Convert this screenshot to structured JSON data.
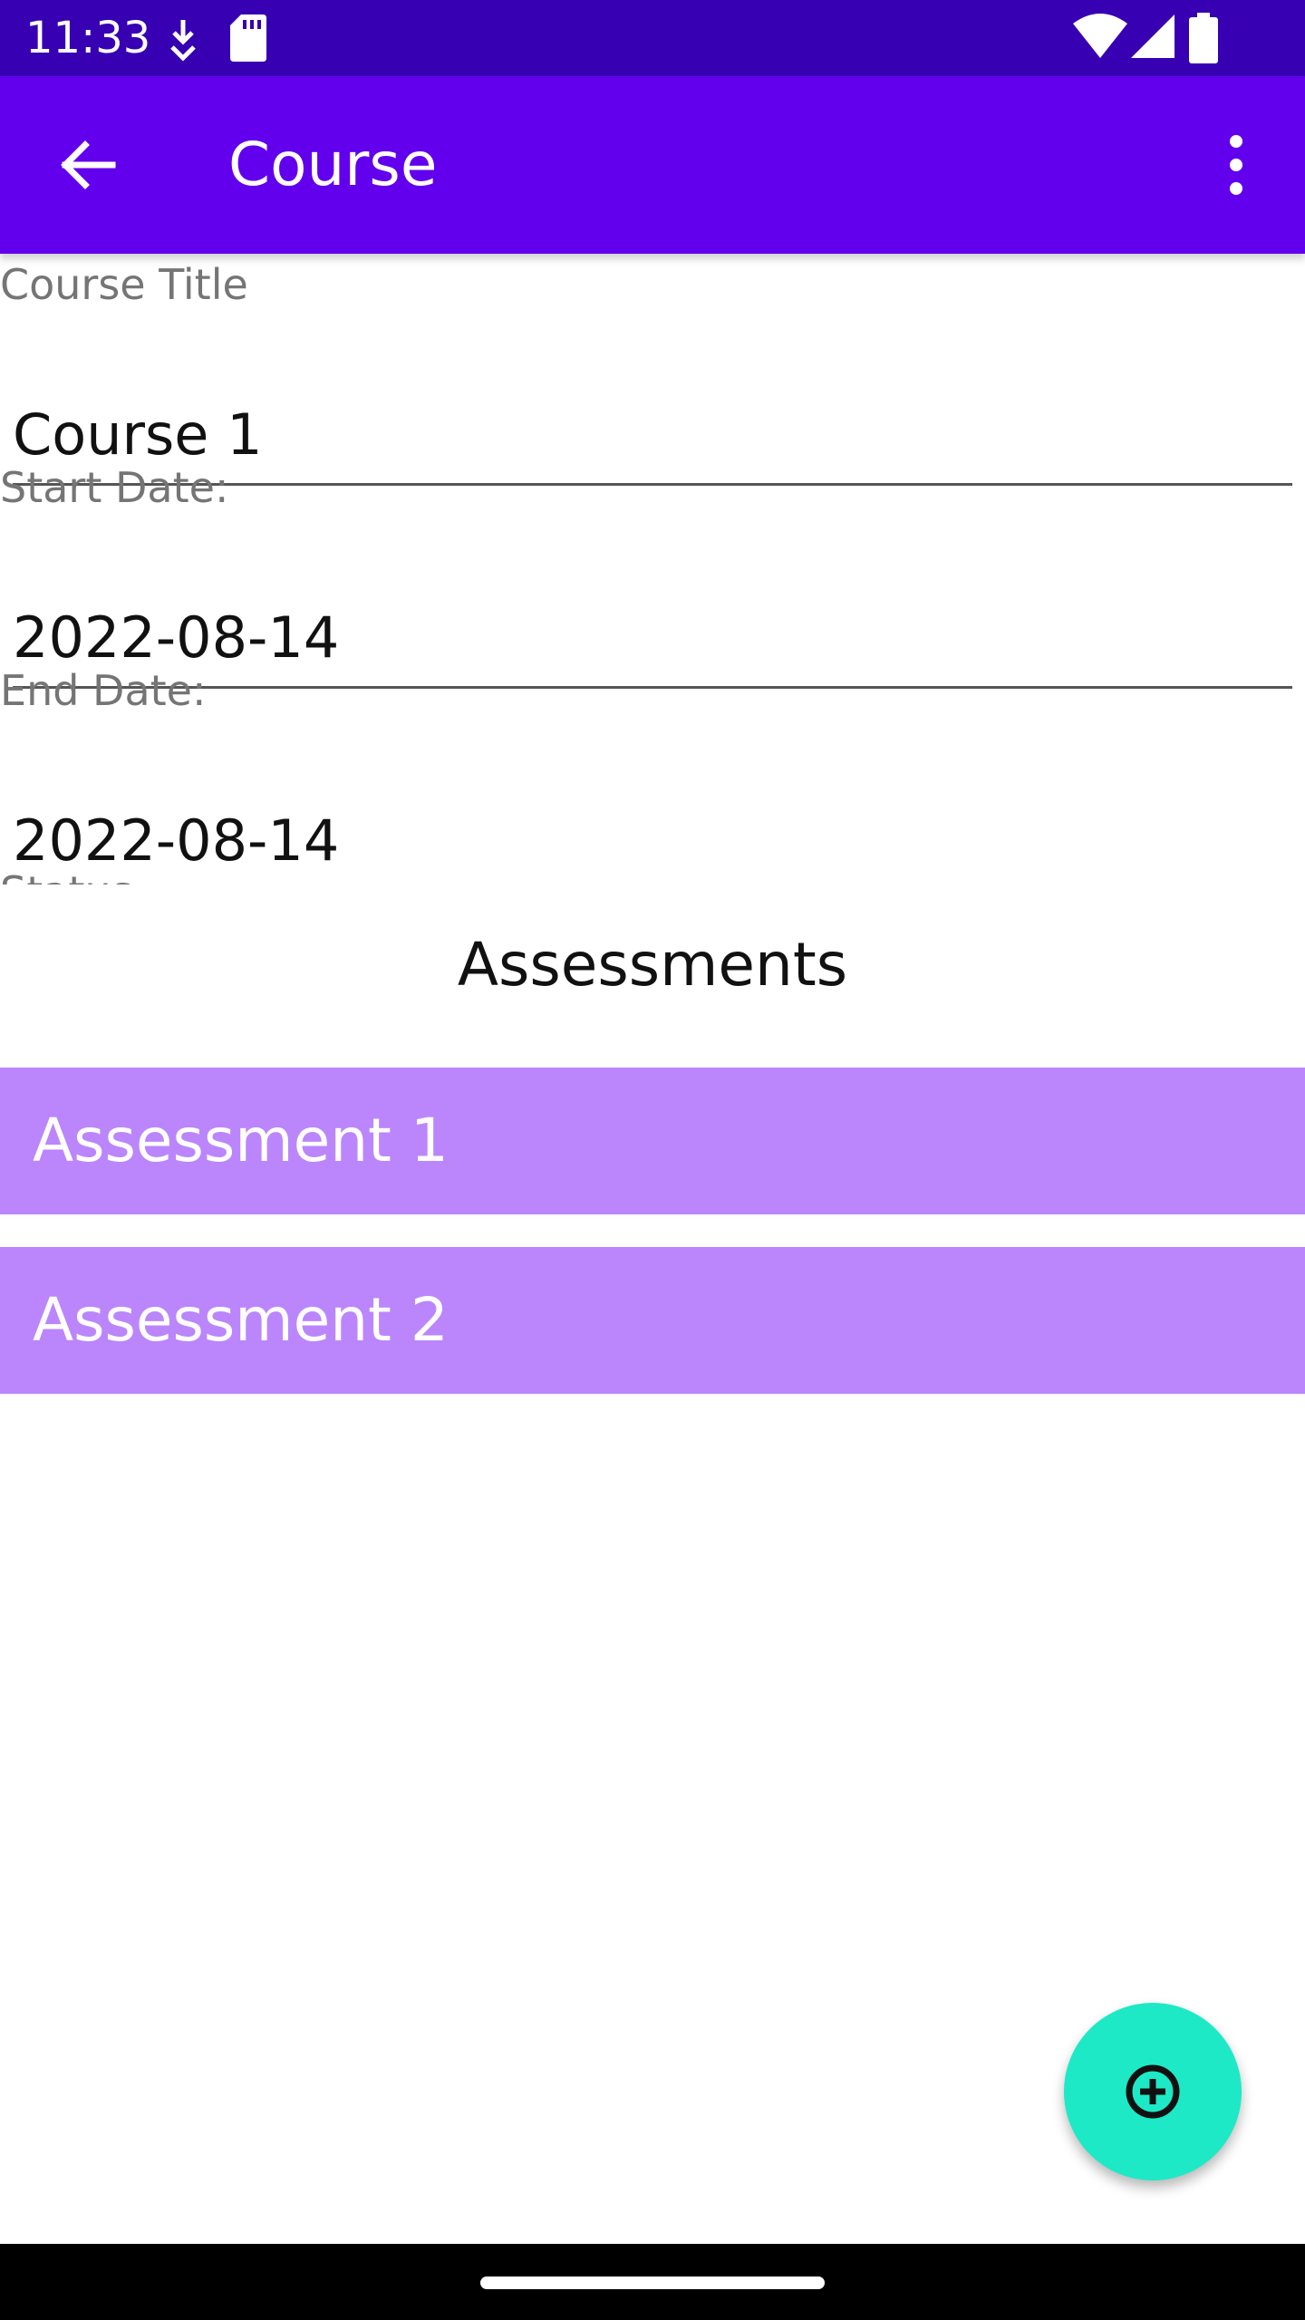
{
  "status_bar": {
    "time": "11:33",
    "icons": [
      "download-status-icon",
      "sd-card-icon",
      "wifi-icon",
      "cell-signal-icon",
      "battery-icon"
    ]
  },
  "app_bar": {
    "title": "Course",
    "back_icon": "arrow-back-icon",
    "menu_icon": "more-vert-icon",
    "color": "#6200ee"
  },
  "form": {
    "course_title_label": "Course Title",
    "course_title_value": "Course 1",
    "start_date_label": "Start Date:",
    "start_date_value": "2022-08-14",
    "end_date_label": "End Date:",
    "end_date_value": "2022-08-14",
    "status_label_partial": "Status:"
  },
  "assessments": {
    "title": "Assessments",
    "items": [
      {
        "label": "Assessment 1"
      },
      {
        "label": "Assessment 2"
      }
    ],
    "item_color": "#bb86fc"
  },
  "fab": {
    "icon": "add-circle-icon",
    "color": "#1de9c6"
  }
}
